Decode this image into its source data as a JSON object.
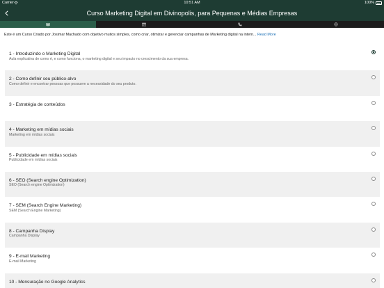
{
  "status_bar": {
    "carrier": "Carrier",
    "time": "10:51 AM",
    "battery": "100%"
  },
  "nav": {
    "title": "Curso Marketing Digital em Divinopolis, para Pequenas e Médias Empresas"
  },
  "tabs": [
    {
      "icon": "book-icon",
      "active": true
    },
    {
      "icon": "calendar-icon",
      "active": false
    },
    {
      "icon": "phone-icon",
      "active": false
    },
    {
      "icon": "globe-icon",
      "active": false
    }
  ],
  "description": {
    "text": "Este é um Curso Criado por Josimar Machado com objetivo muitos simples, como criar, otimizar e gerenciar campanhas de Marketing digital na intern... ",
    "read_more": "Read More"
  },
  "lessons": [
    {
      "title": "1 - Introduzindo o Marketing Digital",
      "subtitle": "Aula explicativa de como é, e como funciona, o marketing digital e seu impacto no crescimento da sua empresa.",
      "selected": true
    },
    {
      "title": "2 - Como definir seu público-alvo",
      "subtitle": "Como definir e encontrar pessoas que possuem a necessidade do seu produto.",
      "selected": false
    },
    {
      "title": "3 - Estratégia de conteúdos",
      "subtitle": "",
      "selected": false
    },
    {
      "title": "4 - Marketing em mídias sociais",
      "subtitle": "Marketing em mídias sociais",
      "selected": false
    },
    {
      "title": "5 - Publicidade em mídias sociais",
      "subtitle": "Publicidade em mídias sociais",
      "selected": false
    },
    {
      "title": "6 - SEO (Search engine Optimization)",
      "subtitle": "SEO (Search engine Optimization)",
      "selected": false
    },
    {
      "title": "7 - SEM (Search Engine Marketing)",
      "subtitle": "SEM (Search Engine Marketing)",
      "selected": false
    },
    {
      "title": "8 - Campanha Display",
      "subtitle": "Campanha Display",
      "selected": false
    },
    {
      "title": "9 - E-mail Marketing",
      "subtitle": "E-mail Marketing",
      "selected": false
    },
    {
      "title": "10 - Mensuração no Google Analytics",
      "subtitle": "",
      "selected": false
    }
  ],
  "colors": {
    "header": "#1e3c33",
    "tab_bar": "#1c1c1c",
    "tab_active": "#2b5e4a",
    "link": "#1a6fb5",
    "row_shaded": "#f0f0f0"
  }
}
